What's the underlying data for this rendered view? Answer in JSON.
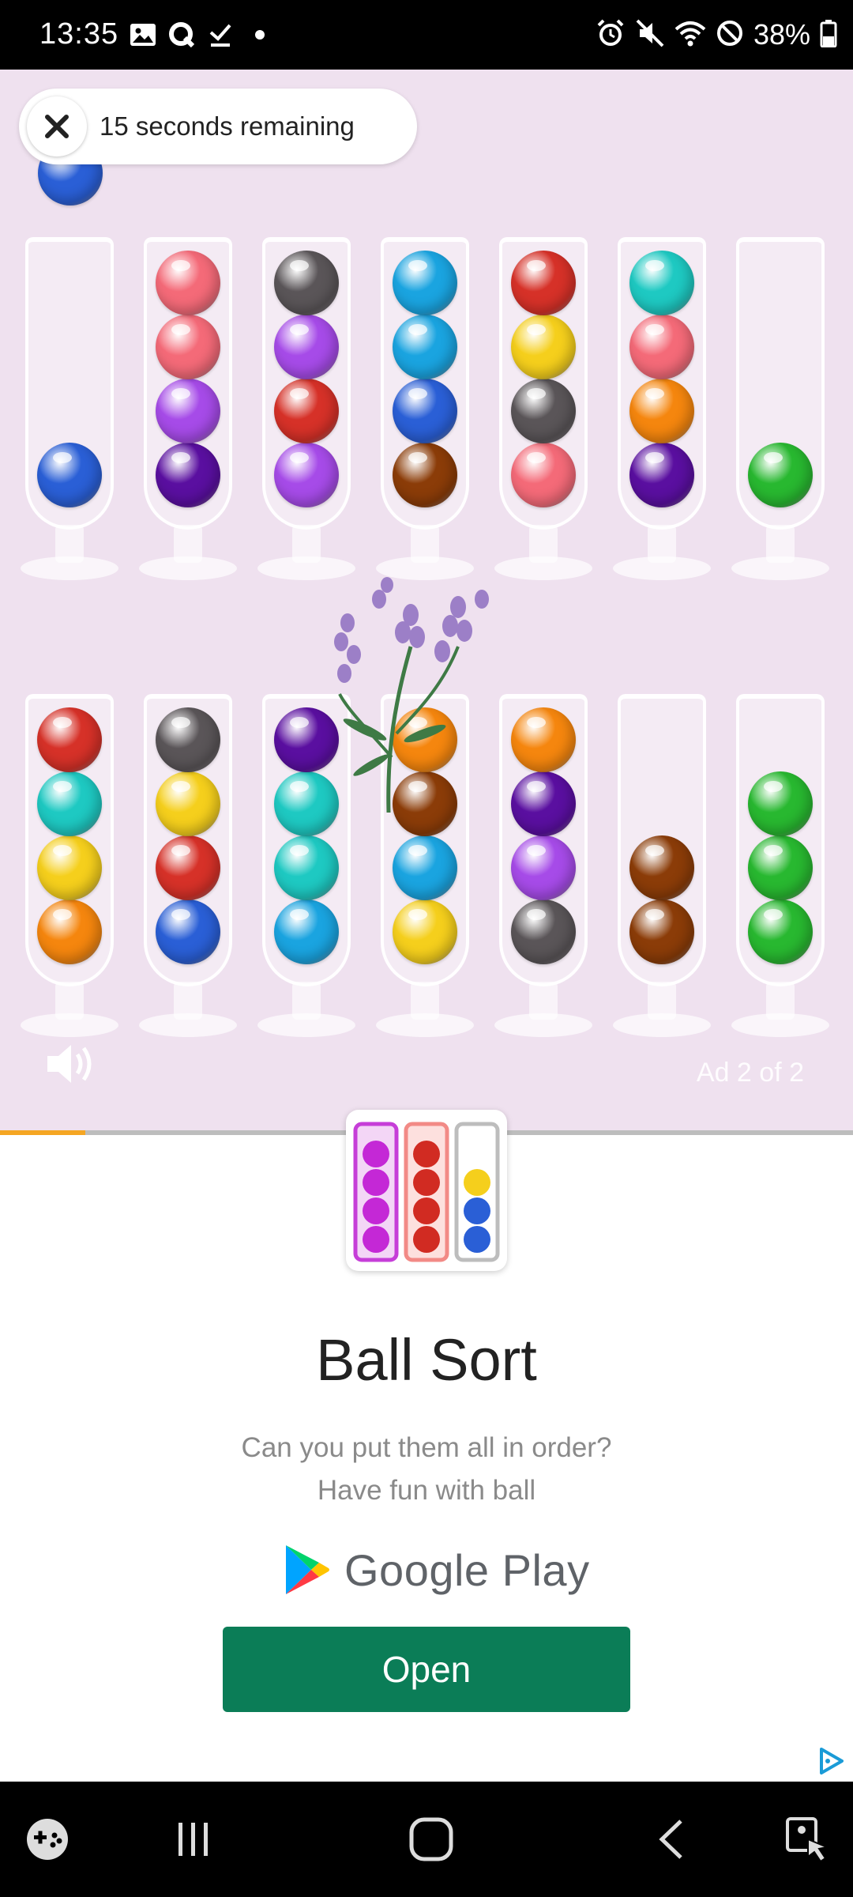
{
  "status_bar": {
    "time": "13:35",
    "battery_text": "38%",
    "left_icons": [
      "gallery-icon",
      "q-app-icon",
      "download-done-icon",
      "dot-icon"
    ],
    "right_icons": [
      "alarm-icon",
      "mute-icon",
      "wifi-icon",
      "do-not-disturb-icon",
      "battery-icon"
    ]
  },
  "ad": {
    "timer_text": "15 seconds remaining",
    "ad_counter": "Ad 2 of 2",
    "progress_fraction": 0.1,
    "game_preview": {
      "floating_ball": "#2a5fd6",
      "top_row": [
        [
          "#2a5fd6"
        ],
        [
          "#5a0fa0",
          "#a64be8",
          "#f46a78",
          "#f46a78"
        ],
        [
          "#a64be8",
          "#d63128",
          "#a64be8",
          "#5a5558"
        ],
        [
          "#8b3c08",
          "#2a5fd6",
          "#1aa4e0",
          "#1aa4e0"
        ],
        [
          "#f46a78",
          "#5a5558",
          "#f5cf1c",
          "#d63128"
        ],
        [
          "#5a0fa0",
          "#f5860e",
          "#f46a78",
          "#1ec9c2"
        ],
        [
          "#28b830"
        ]
      ],
      "bottom_row": [
        [
          "#f5860e",
          "#f5cf1c",
          "#1ec9c2",
          "#d63128"
        ],
        [
          "#2a5fd6",
          "#d63128",
          "#f5cf1c",
          "#5a5558"
        ],
        [
          "#1aa4e0",
          "#1ec9c2",
          "#1ec9c2",
          "#5a0fa0"
        ],
        [
          "#f5cf1c",
          "#1aa4e0",
          "#8b3c08",
          "#f5860e"
        ],
        [
          "#5a5558",
          "#a64be8",
          "#5a0fa0",
          "#f5860e"
        ],
        [
          "#8b3c08",
          "#8b3c08"
        ],
        [
          "#28b830",
          "#28b830",
          "#28b830"
        ]
      ]
    },
    "app_name": "Ball Sort",
    "description_line1": "Can you put them all in order?",
    "description_line2": "Have fun with ball",
    "store_label": "Google Play",
    "open_button": "Open",
    "colors": {
      "open_button": "#0b7d57",
      "progress": "#f5a623",
      "background": "#efe1ef"
    }
  },
  "nav_bar": {
    "items": [
      "game-launcher-icon",
      "recents-icon",
      "home-icon",
      "back-icon",
      "accessibility-icon"
    ]
  }
}
